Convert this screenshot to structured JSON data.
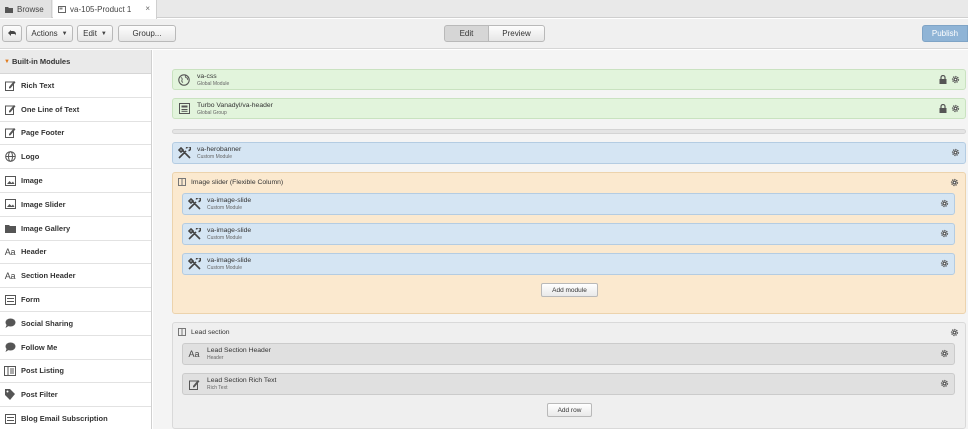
{
  "tabs": [
    {
      "label": "Browse"
    },
    {
      "label": "va-105-Product 1",
      "close": "×"
    }
  ],
  "toolbar": {
    "actions_label": "Actions",
    "edit_label": "Edit",
    "group_label": "Group...",
    "mode_edit": "Edit",
    "mode_preview": "Preview",
    "publish_label": "Publish"
  },
  "sidebar": {
    "header": "Built-in Modules",
    "items": [
      {
        "label": "Rich Text",
        "icon": "pencil-square-icon"
      },
      {
        "label": "One Line of Text",
        "icon": "pencil-square-icon"
      },
      {
        "label": "Page Footer",
        "icon": "pencil-square-icon"
      },
      {
        "label": "Logo",
        "icon": "globe-icon"
      },
      {
        "label": "Image",
        "icon": "image-icon"
      },
      {
        "label": "Image Slider",
        "icon": "image-icon"
      },
      {
        "label": "Image Gallery",
        "icon": "folder-icon"
      },
      {
        "label": "Header",
        "icon": "text-aa-icon"
      },
      {
        "label": "Section Header",
        "icon": "text-aa-icon"
      },
      {
        "label": "Form",
        "icon": "form-icon"
      },
      {
        "label": "Social Sharing",
        "icon": "speech-bubble-icon"
      },
      {
        "label": "Follow Me",
        "icon": "speech-bubble-icon"
      },
      {
        "label": "Post Listing",
        "icon": "post-listing-icon"
      },
      {
        "label": "Post Filter",
        "icon": "tag-icon"
      },
      {
        "label": "Blog Email Subscription",
        "icon": "form-icon"
      }
    ]
  },
  "canvas": {
    "global_modules": [
      {
        "title": "va-css",
        "subtitle": "Global Module"
      },
      {
        "title": "Turbo Vanadyl/va-header",
        "subtitle": "Global Group"
      }
    ],
    "herobanner": {
      "title": "va-herobanner",
      "subtitle": "Custom Module"
    },
    "image_slider_group": {
      "title": "Image slider (Flexible Column)",
      "slides": [
        {
          "title": "va-image-slide",
          "subtitle": "Custom Module"
        },
        {
          "title": "va-image-slide",
          "subtitle": "Custom Module"
        },
        {
          "title": "va-image-slide",
          "subtitle": "Custom Module"
        }
      ],
      "add_label": "Add module"
    },
    "lead_section_group": {
      "title": "Lead section",
      "modules": [
        {
          "title": "Lead Section Header",
          "subtitle": "Header"
        },
        {
          "title": "Lead Section Rich Text",
          "subtitle": "Rich Text"
        }
      ],
      "add_label": "Add row"
    }
  },
  "colors": {
    "global_module_bg": "#e2f4dc",
    "custom_module_bg": "#d5e5f3",
    "flex_column_bg": "#fbe9cf",
    "publish_bg": "#8fb4d6"
  }
}
